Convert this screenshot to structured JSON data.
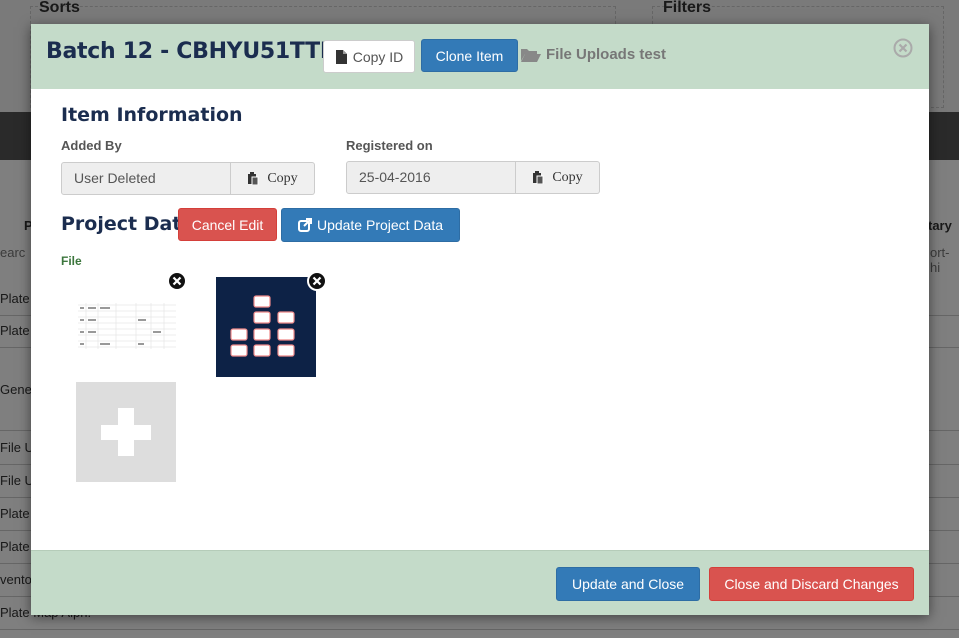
{
  "background": {
    "sorts_title": "Sorts",
    "filters_title": "Filters",
    "col_header_left": "P",
    "col_header_right": "tary",
    "search_left": "earc",
    "search_right": "ort-hi",
    "rows": [
      "Plate",
      "Plate",
      "Gene",
      "File U",
      "File U",
      "Plate",
      "Plate",
      "vento",
      "Plate Map Alph."
    ]
  },
  "modal": {
    "title": "Batch 12 - CBHYU51TTN",
    "copy_id_label": "Copy ID",
    "clone_label": "Clone Item",
    "upload_link": "File Uploads test",
    "close_icon": "close-circle-icon"
  },
  "item_info": {
    "heading": "Item Information",
    "added_by_label": "Added By",
    "added_by_value": "User Deleted",
    "registered_label": "Registered on",
    "registered_value": "25-04-2016",
    "copy_label": "Copy"
  },
  "project": {
    "heading": "Project Data",
    "cancel_label": "Cancel Edit",
    "update_label": "Update Project Data",
    "file_label": "File"
  },
  "footer": {
    "update_close_label": "Update and Close",
    "discard_label": "Close and Discard Changes"
  },
  "colors": {
    "header_bg": "#c4dbc9",
    "title": "#1b2d4f",
    "primary": "#337ab7",
    "danger": "#d9534f",
    "thumb_dark": "#0d2246"
  }
}
